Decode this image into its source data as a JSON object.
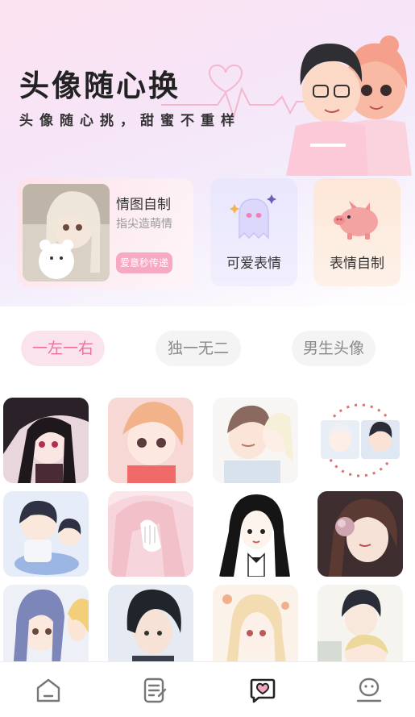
{
  "hero": {
    "title": "头像随心换",
    "subtitle": "头像随心挑，甜蜜不重样"
  },
  "features": {
    "card_diy": {
      "title": "情图自制",
      "desc": "指尖造萌情",
      "button": "爱意秒传递"
    },
    "cute_emoji": {
      "label": "可爱表情",
      "icon": "ghost-icon"
    },
    "emoji_diy": {
      "label": "表情自制",
      "icon": "piggy-icon"
    }
  },
  "category_tabs": [
    {
      "label": "一左一右",
      "active": true
    },
    {
      "label": "独一无二",
      "active": false
    },
    {
      "label": "男生头像",
      "active": false
    }
  ],
  "bottom_nav": [
    {
      "icon": "home-icon"
    },
    {
      "icon": "notes-icon"
    },
    {
      "icon": "heart-chat-icon",
      "active": true
    },
    {
      "icon": "profile-icon"
    }
  ],
  "colors": {
    "accent": "#ee6ea2",
    "active_tab_bg": "#fbe3ee",
    "inactive_tab_bg": "#f4f4f4",
    "button_pink": "#f7a9c4"
  }
}
